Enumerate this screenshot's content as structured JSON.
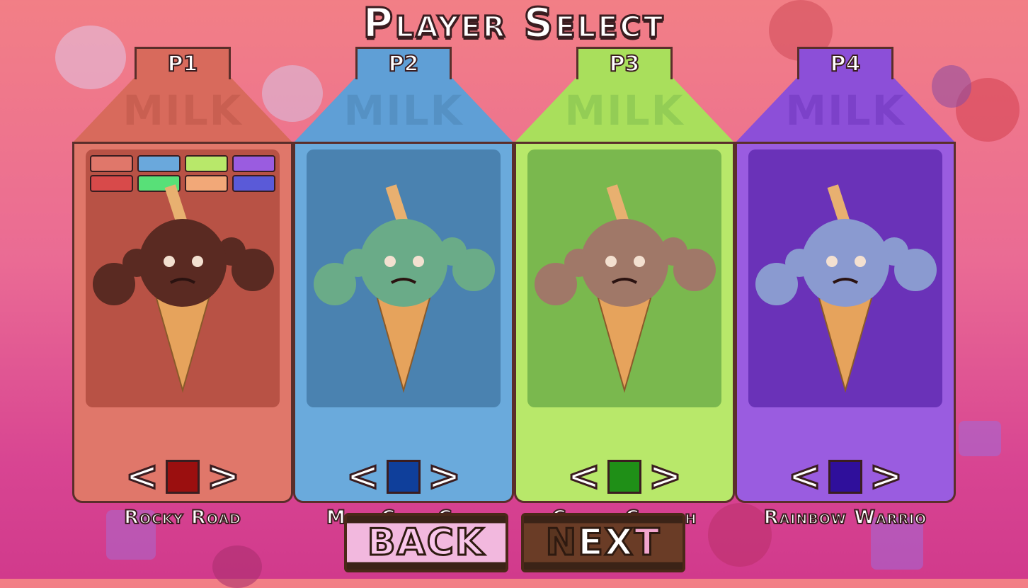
{
  "title": "Player Select",
  "milk_label": "MILK",
  "players": [
    {
      "tab": "P1",
      "character": "Rocky Road",
      "carton_color": "#e0776a",
      "roof_color": "#d86a5c",
      "panel_color": "#b85245",
      "selected_color": "#9b0f0f",
      "scoop_color": "#5a2a22",
      "show_palette": true,
      "palette": [
        "#e0776a",
        "#6aa8dc",
        "#b8e86a",
        "#9a5ce0",
        "#d84a4a",
        "#58e078",
        "#f2a878",
        "#5a5ad8"
      ]
    },
    {
      "tab": "P2",
      "character": "Mint Chop Chip",
      "carton_color": "#6aaadc",
      "roof_color": "#5f9fd6",
      "panel_color": "#4a82b0",
      "selected_color": "#0f3f9b",
      "scoop_color": "#6aab88",
      "show_palette": false
    },
    {
      "tab": "P3",
      "character": "Cookie Crunch",
      "carton_color": "#b8e86a",
      "roof_color": "#a9df5c",
      "panel_color": "#7ab84e",
      "selected_color": "#1f8f17",
      "scoop_color": "#a07868",
      "show_palette": false
    },
    {
      "tab": "P4",
      "character": "Rainbow Warrio",
      "carton_color": "#9a5ce0",
      "roof_color": "#8c4fd8",
      "panel_color": "#6a32b8",
      "selected_color": "#2f0f9b",
      "scoop_color": "#8a9ad0",
      "show_palette": false
    }
  ],
  "arrows": {
    "left": "<",
    "right": ">"
  },
  "buttons": {
    "back": "BACK",
    "next": "NEXT"
  }
}
